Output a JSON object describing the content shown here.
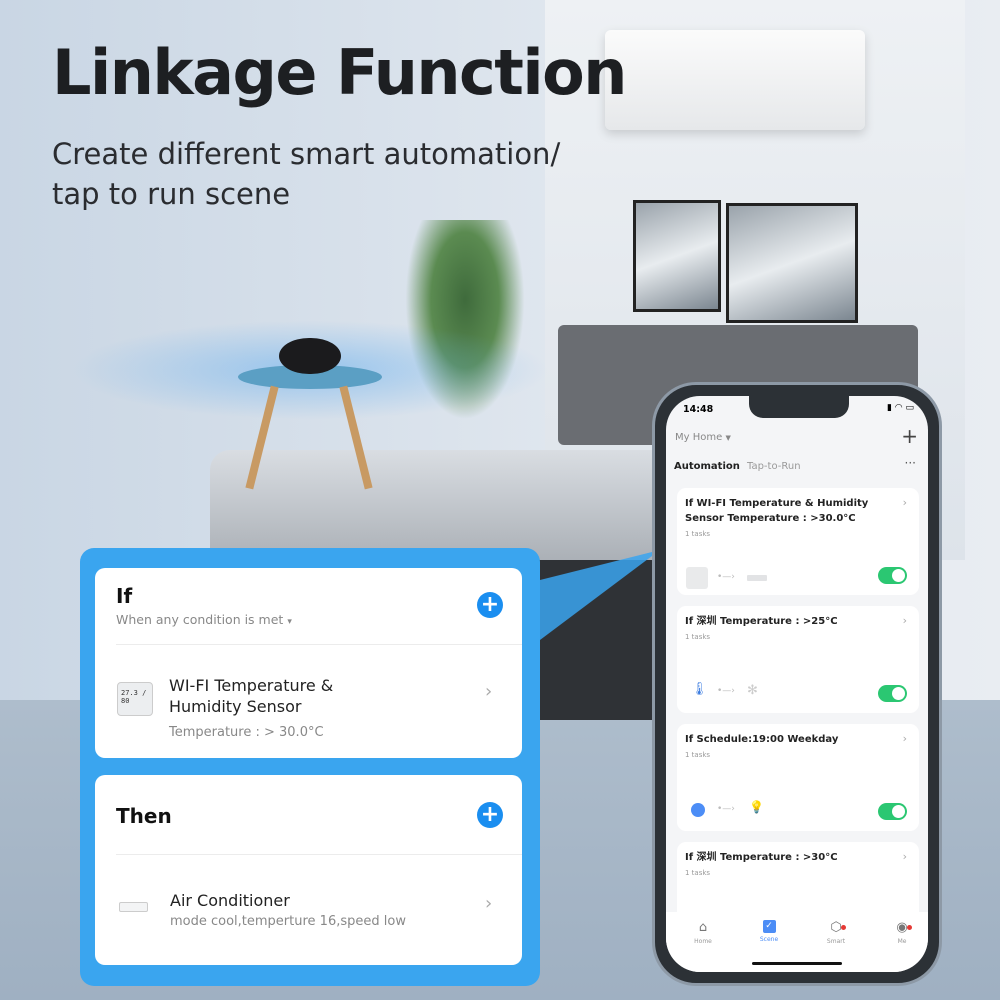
{
  "headline": "Linkage Function",
  "subheadline": "Create different smart automation/ tap to run scene",
  "if_card": {
    "title": "If",
    "condition_mode": "When any condition is met",
    "device_name": "WI-FI Temperature & Humidity Sensor",
    "device_detail": "Temperature : > 30.0°C",
    "sensor_display": "27.3 / 80"
  },
  "then_card": {
    "title": "Then",
    "device_name": "Air Conditioner",
    "device_detail": "mode cool,temperture 16,speed low"
  },
  "phone": {
    "status": {
      "time": "14:48"
    },
    "home_selector": "My Home",
    "tabs": [
      {
        "label": "Automation",
        "active": true
      },
      {
        "label": "Tap-to-Run",
        "active": false
      }
    ],
    "automations": [
      {
        "title": "If WI-FI Temperature & Humidity Sensor Temperature : >30.0°C",
        "tasks": "1 tasks",
        "enabled": true,
        "from_icon": "sensor-icon",
        "to_icon": "air-conditioner-icon"
      },
      {
        "title": "If 深圳 Temperature : >25°C",
        "tasks": "1 tasks",
        "enabled": true,
        "from_icon": "thermometer-icon",
        "to_icon": "fan-icon"
      },
      {
        "title": "If Schedule:19:00 Weekday",
        "tasks": "1 tasks",
        "enabled": true,
        "from_icon": "clock-icon",
        "to_icon": "bulb-icon"
      },
      {
        "title": "If 深圳 Temperature : >30°C",
        "tasks": "1 tasks"
      }
    ],
    "nav": [
      {
        "label": "Home"
      },
      {
        "label": "Scene",
        "active": true
      },
      {
        "label": "Smart"
      },
      {
        "label": "Me"
      }
    ]
  },
  "colors": {
    "panel": "#3aa5ef",
    "accent": "#1a8ef0",
    "toggle_on": "#2bc772",
    "scene_active": "#4c8df6"
  }
}
